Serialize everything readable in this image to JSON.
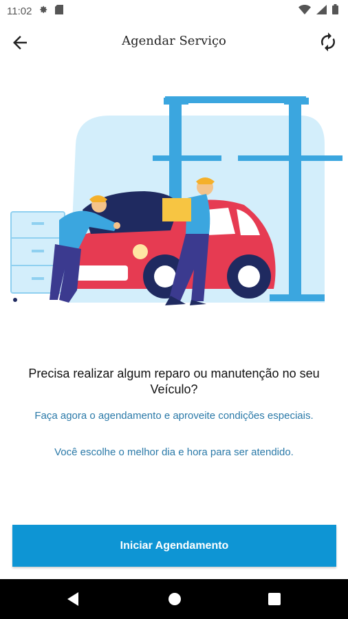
{
  "status_bar": {
    "time": "11:02",
    "icons": [
      "settings-icon",
      "sd-card-icon",
      "wifi-icon",
      "signal-icon",
      "battery-icon"
    ]
  },
  "app_bar": {
    "title": "Agendar Serviço",
    "icons": [
      "arrow-back-icon",
      "refresh-icon"
    ]
  },
  "content": {
    "heading": "Precisa realizar algum reparo ou manutenção no seu Veículo?",
    "subtext_1": "Faça agora o agendamento e aproveite condições especiais.",
    "subtext_2": "Você escolhe o melhor dia e hora para ser atendido."
  },
  "cta": {
    "label": "Iniciar Agendamento"
  },
  "nav_bar": {
    "icons": [
      "nav-back-icon",
      "nav-home-icon",
      "nav-recents-icon"
    ]
  },
  "colors": {
    "accent": "#0e95d4",
    "text_blue": "#2a79a8",
    "car_red": "#e63b52",
    "light_blue": "#d3eefb"
  }
}
